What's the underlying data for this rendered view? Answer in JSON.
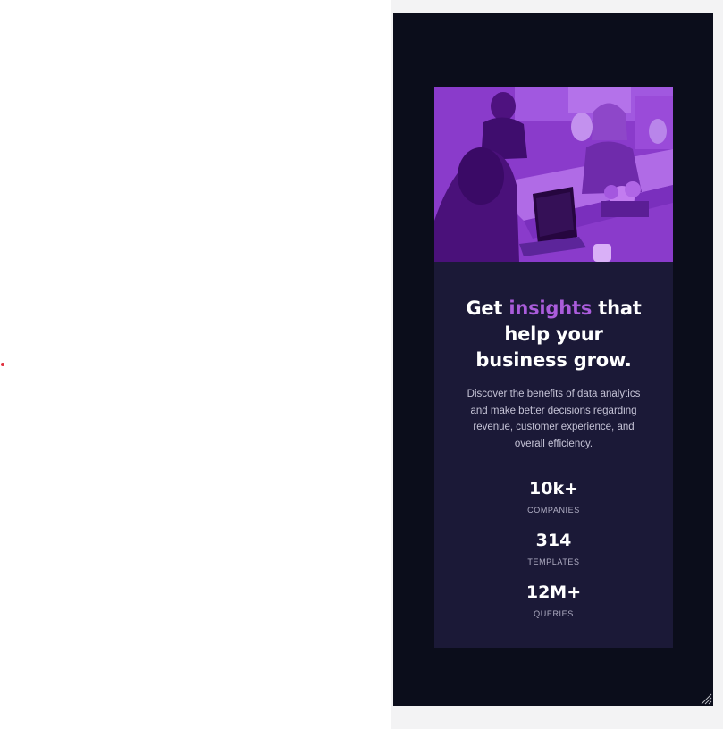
{
  "card": {
    "heading": {
      "before": "Get ",
      "accent": "insights",
      "after": " that help your business grow."
    },
    "description": "Discover the benefits of data analytics and make better decisions regarding revenue, customer experience, and overall efficiency.",
    "stats": [
      {
        "value": "10k+",
        "label": "COMPANIES"
      },
      {
        "value": "314",
        "label": "TEMPLATES"
      },
      {
        "value": "12M+",
        "label": "QUERIES"
      }
    ]
  },
  "colors": {
    "frame_background": "#0b0d1b",
    "card_background": "#1b1937",
    "accent": "#aa5cdb",
    "image_overlay": "#8b3ccc"
  },
  "icons": [
    "resize-grip-icon"
  ]
}
